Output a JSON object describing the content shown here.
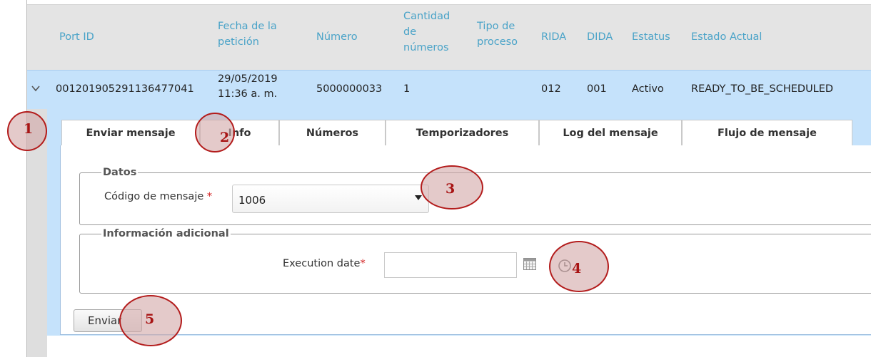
{
  "table": {
    "headers": {
      "port_id": "Port ID",
      "fecha_1": "Fecha de la",
      "fecha_2": "petición",
      "numero": "Número",
      "cantidad_1": "Cantidad",
      "cantidad_2": "de",
      "cantidad_3": "números",
      "tipo_1": "Tipo de",
      "tipo_2": "proceso",
      "rida": "RIDA",
      "dida": "DIDA",
      "estatus": "Estatus",
      "estado_actual": "Estado Actual"
    },
    "row": {
      "port_id": "001201905291136477041",
      "fecha_date": "29/05/2019",
      "fecha_time": "11:36 a. m.",
      "numero": "5000000033",
      "cantidad": "1",
      "rida": "012",
      "dida": "001",
      "estatus": "Activo",
      "estado_actual": "READY_TO_BE_SCHEDULED"
    }
  },
  "tabs": [
    {
      "label": "Enviar mensaje",
      "active": true
    },
    {
      "label": "Info",
      "active": false
    },
    {
      "label": "Números",
      "active": false
    },
    {
      "label": "Temporizadores",
      "active": false
    },
    {
      "label": "Log del mensaje",
      "active": false
    },
    {
      "label": "Flujo de mensaje",
      "active": false
    }
  ],
  "form": {
    "datos_legend": "Datos",
    "codigo_label": "Código de mensaje",
    "codigo_value": "1006",
    "info_legend": "Información adicional",
    "execution_label": "Execution date",
    "execution_value": "",
    "required_mark": "*",
    "send_button": "Enviar"
  },
  "markers": [
    "1",
    "2",
    "3",
    "4",
    "5"
  ],
  "colors": {
    "header_text": "#4aa3c8",
    "row_selected": "#c5e2fb",
    "marker_border": "#b31c1c",
    "marker_text": "#a81414",
    "required": "#d21f1f"
  },
  "icons": [
    "chevron-down-icon",
    "calendar-icon",
    "clock-icon",
    "dropdown-caret-icon"
  ]
}
